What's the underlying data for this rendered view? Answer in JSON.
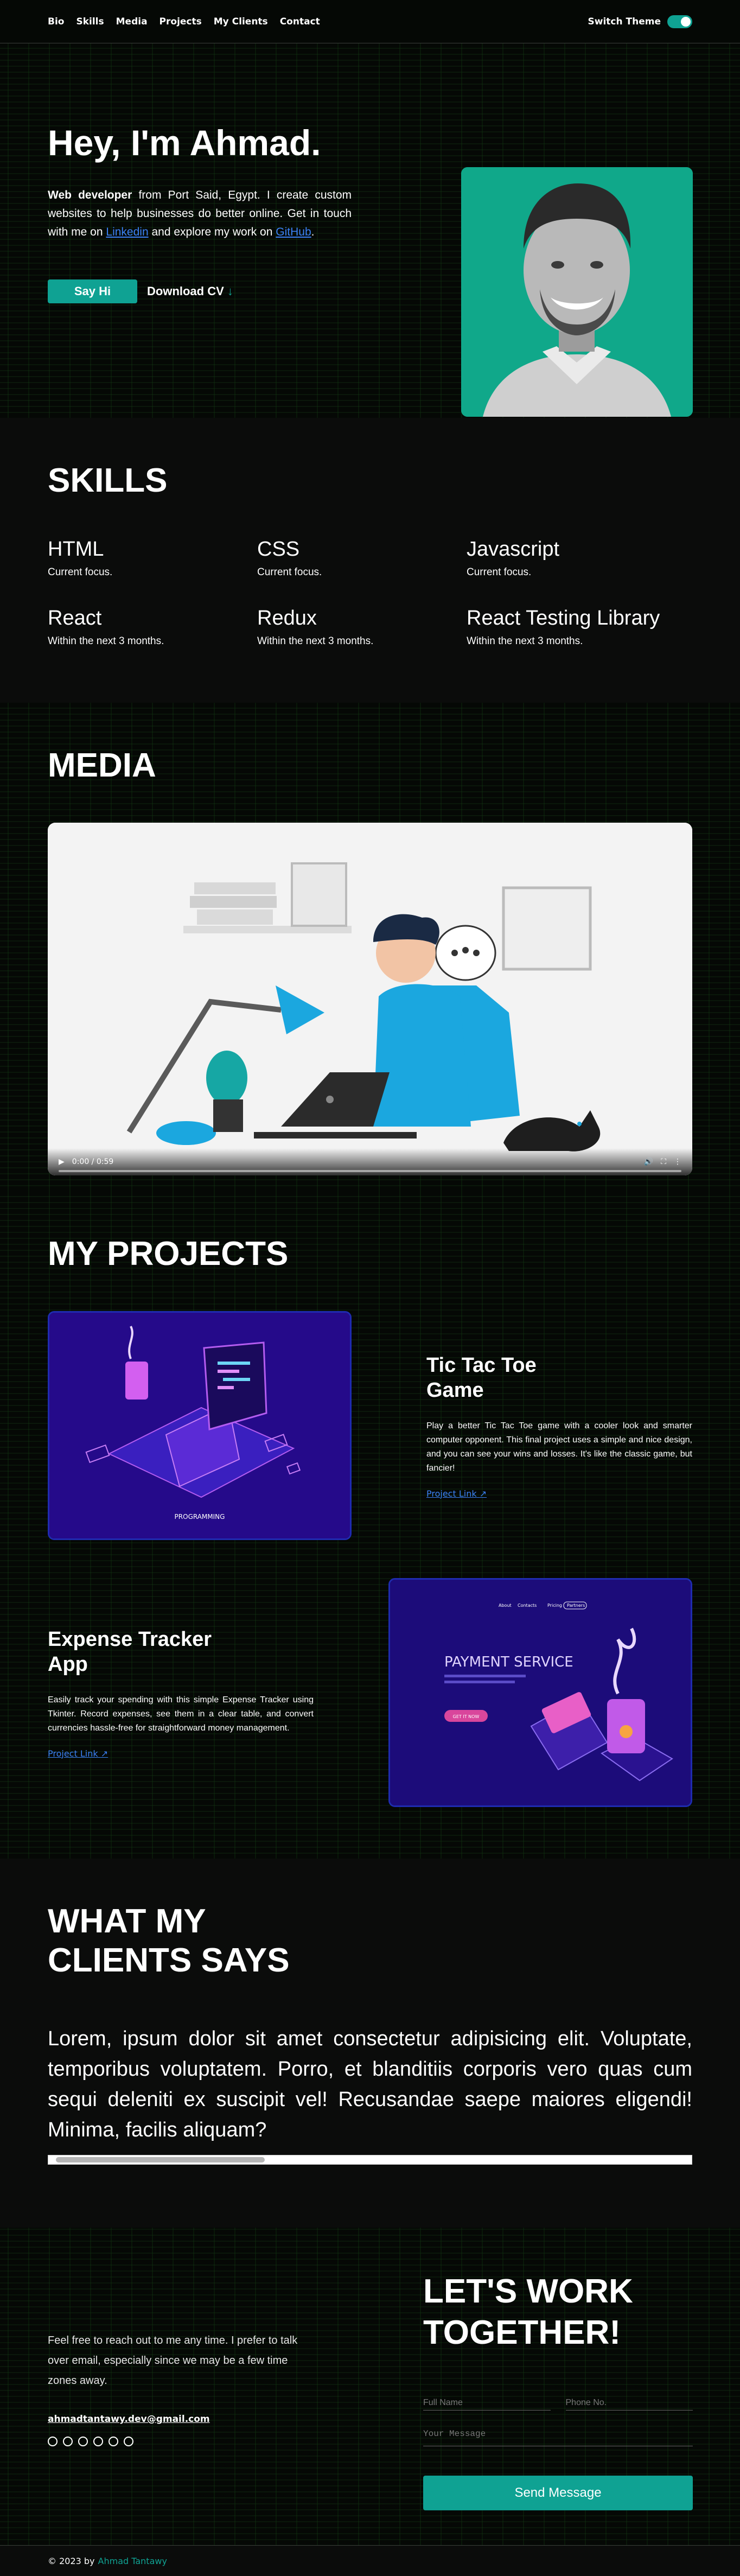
{
  "nav": {
    "links": [
      "Bio",
      "Skills",
      "Media",
      "Projects",
      "My Clients",
      "Contact"
    ],
    "theme_label": "Switch Theme"
  },
  "hero": {
    "greeting": "Hey, I'm Ahmad.",
    "role": "Web developer",
    "intro_mid": "from Port Said, Egypt. I create custom websites to help businesses do better online. Get in touch with me on",
    "linkedin": "Linkedin",
    "intro_and": "and explore my work on",
    "github": "GitHub",
    "say_hi": "Say Hi",
    "download_cv": "Download CV",
    "download_arrow": "↓"
  },
  "skills": {
    "title": "SKILLS",
    "items": [
      {
        "name": "HTML",
        "note": "Current focus."
      },
      {
        "name": "CSS",
        "note": "Current focus."
      },
      {
        "name": "Javascript",
        "note": "Current focus."
      },
      {
        "name": "React",
        "note": "Within the next 3 months."
      },
      {
        "name": "Redux",
        "note": "Within the next 3 months."
      },
      {
        "name": "React Testing Library",
        "note": "Within the next 3 months."
      }
    ]
  },
  "media": {
    "title": "MEDIA",
    "time": "0:00 / 0:59"
  },
  "projects": {
    "title": "MY PROJECTS",
    "items": [
      {
        "title_line1": "Tic Tac Toe",
        "title_line2": "Game",
        "desc": "Play a better Tic Tac Toe game with a cooler look and smarter computer opponent. This final project uses a simple and nice design, and you can see your wins and losses. It's like the classic game, but fancier!",
        "link": "Project Link",
        "img_caption": "PROGRAMMING"
      },
      {
        "title_line1": "Expense Tracker",
        "title_line2": "App",
        "desc": "Easily track your spending with this simple Expense Tracker using Tkinter. Record expenses, see them in a clear table, and convert currencies hassle-free for straightforward money management.",
        "link": "Project Link",
        "img_caption": "PAYMENT SERVICE",
        "img_nav": [
          "About",
          "Contacts",
          "Pricing",
          "Partners"
        ],
        "img_button": "GET IT NOW"
      }
    ]
  },
  "clients": {
    "title_line1": "WHAT MY",
    "title_line2": "CLIENTS SAYS",
    "quote": "Lorem, ipsum dolor sit amet consectetur adipisicing elit. Voluptate, temporibus voluptatem. Porro, et blanditiis corporis vero quas cum sequi deleniti ex suscipit vel! Recusandae saepe maiores eligendi! Minima, facilis aliquam?"
  },
  "contact": {
    "text": "Feel free to reach out to me any time. I prefer to talk over email, especially since we may be a few time zones away.",
    "email": "ahmadtantawy.dev@gmail.com",
    "title_line1": "LET'S WORK",
    "title_line2": "TOGETHER!",
    "full_name_placeholder": "Full Name",
    "phone_placeholder": "Phone No.",
    "message_placeholder": "Your Message",
    "send": "Send Message"
  },
  "footer": {
    "copy": "© 2023 by",
    "name": "Ahmad Tantawy"
  },
  "colors": {
    "accent": "#0fa293",
    "link": "#3b82f6",
    "project_border": "#1f2bb0"
  }
}
